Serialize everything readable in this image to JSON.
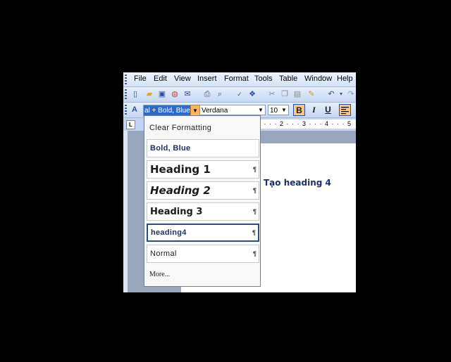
{
  "menubar": {
    "items": [
      "File",
      "Edit",
      "View",
      "Insert",
      "Format",
      "Tools",
      "Table",
      "Window",
      "Help"
    ]
  },
  "toolbar_standard": {
    "icons": [
      "new-document-icon",
      "open-icon",
      "save-icon",
      "permission-icon",
      "email-icon",
      "print-icon",
      "print-preview-icon",
      "spelling-icon",
      "research-icon",
      "cut-icon",
      "copy-icon",
      "paste-icon",
      "format-painter-icon",
      "undo-icon",
      "redo-icon"
    ]
  },
  "toolbar_formatting": {
    "style_value": "al + Bold, Blue",
    "font_value": "Verdana",
    "size_value": "10",
    "bold_label": "B",
    "italic_label": "I",
    "underline_label": "U"
  },
  "ruler": {
    "corner_label": "L",
    "ticks": "1 · · · 2 · · · 3 · · · 4 · · · 5"
  },
  "document": {
    "text": "Tạo heading 4"
  },
  "style_dropdown": {
    "clear_formatting": "Clear Formatting",
    "items": [
      {
        "label": "Bold, Blue",
        "pilcrow": ""
      },
      {
        "label": "Heading 1",
        "pilcrow": "¶"
      },
      {
        "label": "Heading 2",
        "pilcrow": "¶"
      },
      {
        "label": "Heading 3",
        "pilcrow": "¶"
      },
      {
        "label": "heading4",
        "pilcrow": "¶"
      },
      {
        "label": "Normal",
        "pilcrow": "¶"
      }
    ],
    "more": "More..."
  },
  "colors": {
    "selection": "#316ac5",
    "toolbar": "#c5d7f3",
    "active_button": "#ffc57a",
    "style_text": "#1f2f6b"
  }
}
